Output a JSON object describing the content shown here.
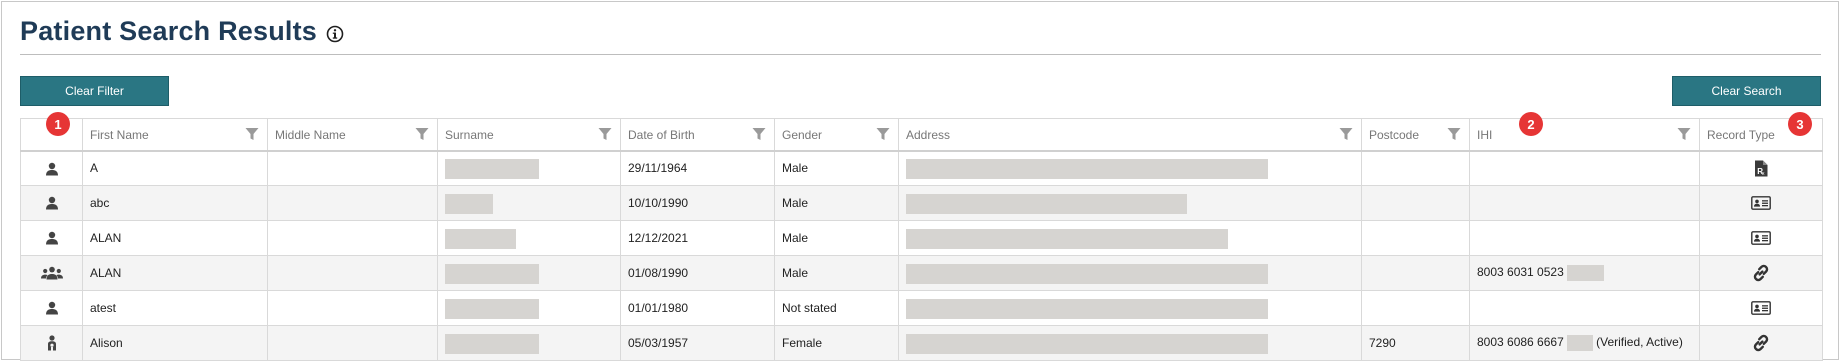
{
  "page": {
    "title": "Patient Search Results"
  },
  "toolbar": {
    "clear_filter_label": "Clear Filter",
    "clear_search_label": "Clear Search"
  },
  "annotations": [
    "1",
    "2",
    "3"
  ],
  "table": {
    "headers": {
      "first_name": "First Name",
      "middle_name": "Middle Name",
      "surname": "Surname",
      "dob": "Date of Birth",
      "gender": "Gender",
      "address": "Address",
      "postcode": "Postcode",
      "ihi": "IHI",
      "record_type": "Record Type"
    },
    "rows": [
      {
        "type_icon": "person-icon",
        "first_name": "A",
        "middle_name": "",
        "dob": "29/11/1964",
        "gender": "Male",
        "postcode": "",
        "ihi": "",
        "ihi_status": "",
        "record_icon": "prescription-icon"
      },
      {
        "type_icon": "person-icon",
        "first_name": "abc",
        "middle_name": "",
        "dob": "10/10/1990",
        "gender": "Male",
        "postcode": "",
        "ihi": "",
        "ihi_status": "",
        "record_icon": "id-card-icon"
      },
      {
        "type_icon": "person-icon",
        "first_name": "ALAN",
        "middle_name": "",
        "dob": "12/12/2021",
        "gender": "Male",
        "postcode": "",
        "ihi": "",
        "ihi_status": "",
        "record_icon": "id-card-icon"
      },
      {
        "type_icon": "group-icon",
        "first_name": "ALAN",
        "middle_name": "",
        "dob": "01/08/1990",
        "gender": "Male",
        "postcode": "",
        "ihi": "8003 6031 0523",
        "ihi_status": "",
        "record_icon": "link-icon"
      },
      {
        "type_icon": "person-icon",
        "first_name": "atest",
        "middle_name": "",
        "dob": "01/01/1980",
        "gender": "Not stated",
        "postcode": "",
        "ihi": "",
        "ihi_status": "",
        "record_icon": "id-card-icon"
      },
      {
        "type_icon": "mother-baby-icon",
        "first_name": "Alison",
        "middle_name": "",
        "dob": "05/03/1957",
        "gender": "Female",
        "postcode": "7290",
        "ihi": "8003 6086 6667",
        "ihi_status": "(Verified, Active)",
        "record_icon": "link-icon"
      }
    ]
  },
  "colors": {
    "title": "#1f3b57",
    "button": "#2a7683",
    "badge": "#e63535",
    "redaction": "#d6d4d1"
  }
}
